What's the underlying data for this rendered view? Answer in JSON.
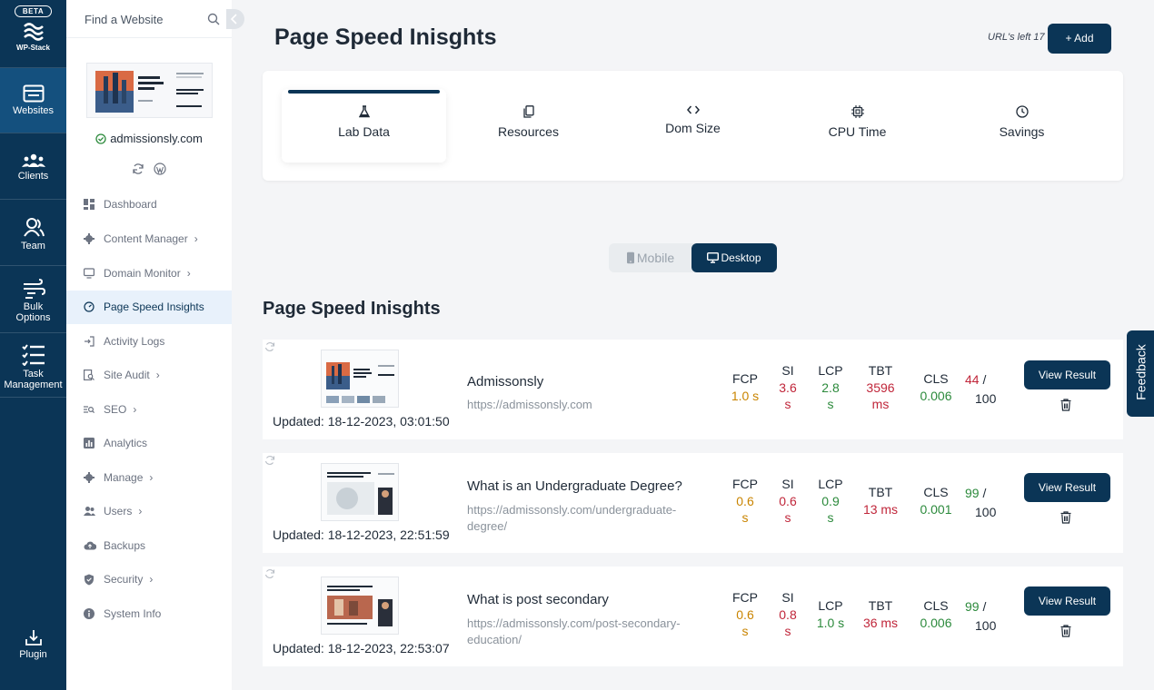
{
  "rail": {
    "beta": "BETA",
    "brand": "WP-Stack",
    "items": [
      {
        "label": "Websites",
        "icon": "websites-icon"
      },
      {
        "label": "Clients",
        "icon": "clients-icon"
      },
      {
        "label": "Team",
        "icon": "team-icon"
      },
      {
        "label": "Bulk Options",
        "icon": "bulk-icon"
      },
      {
        "label": "Task Management",
        "icon": "task-icon"
      },
      {
        "label": "Plugin",
        "icon": "plugin-icon"
      }
    ]
  },
  "sidebar": {
    "search_placeholder": "Find a Website",
    "site_name": "admissionsly.com",
    "nav": [
      {
        "label": "Dashboard"
      },
      {
        "label": "Content Manager"
      },
      {
        "label": "Domain Monitor"
      },
      {
        "label": "Page Speed Insights"
      },
      {
        "label": "Activity Logs"
      },
      {
        "label": "Site Audit"
      },
      {
        "label": "SEO"
      },
      {
        "label": "Analytics"
      },
      {
        "label": "Manage"
      },
      {
        "label": "Users"
      },
      {
        "label": "Backups"
      },
      {
        "label": "Security"
      },
      {
        "label": "System Info"
      }
    ]
  },
  "header": {
    "title": "Page Speed Inisghts",
    "urls_left": "URL's left 17",
    "add_label": "+ Add"
  },
  "tabs": [
    {
      "label": "Lab Data"
    },
    {
      "label": "Resources"
    },
    {
      "label": "Dom Size"
    },
    {
      "label": "CPU Time"
    },
    {
      "label": "Savings"
    }
  ],
  "device": {
    "mobile": "Mobile",
    "desktop": "Desktop",
    "selected": "Desktop"
  },
  "section_title": "Page Speed Inisghts",
  "metric_names": {
    "fcp": "FCP",
    "si": "SI",
    "lcp": "LCP",
    "tbt": "TBT",
    "cls": "CLS"
  },
  "results": [
    {
      "updated": "Updated: 18-12-2023, 03:01:50",
      "title": "Admissonsly",
      "url": "https://admissonsly.com",
      "fcp": "1.0 s",
      "si": "3.6 s",
      "lcp": "2.8 s",
      "tbt": "3596 ms",
      "cls": "0.006",
      "score": "44",
      "score_max": "100"
    },
    {
      "updated": "Updated: 18-12-2023, 22:51:59",
      "title": "What is an Undergraduate Degree?",
      "url": "https://admissonsly.com/undergraduate-degree/",
      "fcp": "0.6 s",
      "si": "0.6 s",
      "lcp": "0.9 s",
      "tbt": "13 ms",
      "cls": "0.001",
      "score": "99",
      "score_max": "100"
    },
    {
      "updated": "Updated: 18-12-2023, 22:53:07",
      "title": "What is post secondary",
      "url": "https://admissonsly.com/post-secondary-education/",
      "fcp": "0.6 s",
      "si": "0.8 s",
      "lcp": "1.0 s",
      "tbt": "36 ms",
      "cls": "0.006",
      "score": "99",
      "score_max": "100"
    }
  ],
  "view_result_label": "View Result",
  "feedback_label": "Feedback",
  "colors": {
    "primary": "#0b3556",
    "good": "#2c8a3c",
    "average": "#c98400",
    "poor": "#c0263a"
  }
}
